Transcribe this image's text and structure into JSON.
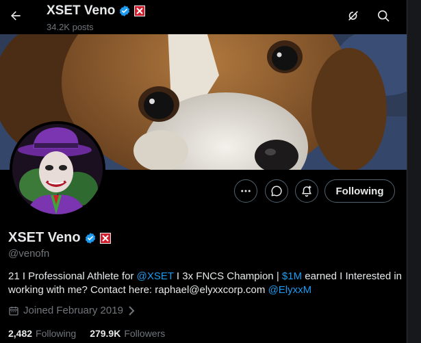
{
  "header": {
    "name": "XSET Veno",
    "posts": "34.2K posts"
  },
  "profile": {
    "name": "XSET Veno",
    "handle": "@venofn",
    "bio": {
      "part1": "21 I Professional Athlete for ",
      "link1": "@XSET",
      "part2": " I 3x FNCS Champion | ",
      "link2": "$1M",
      "part3": " earned I Interested in working with me? Contact here: raphael@elyxxcorp.com ",
      "link3": "@ElyxxM"
    },
    "joined": "Joined February 2019",
    "following_count": "2,482",
    "following_label": "Following",
    "followers_count": "279.9K",
    "followers_label": "Followers"
  },
  "actions": {
    "following_button": "Following"
  },
  "colors": {
    "accent": "#1d9bf0",
    "affiliate_badge": "#d01f2e",
    "muted_text": "#71767b"
  },
  "icons": [
    "back-arrow-icon",
    "verified-icon",
    "affiliate-badge-icon",
    "grok-icon",
    "search-icon",
    "more-icon",
    "message-icon",
    "notify-icon",
    "calendar-icon",
    "chevron-right-icon"
  ]
}
